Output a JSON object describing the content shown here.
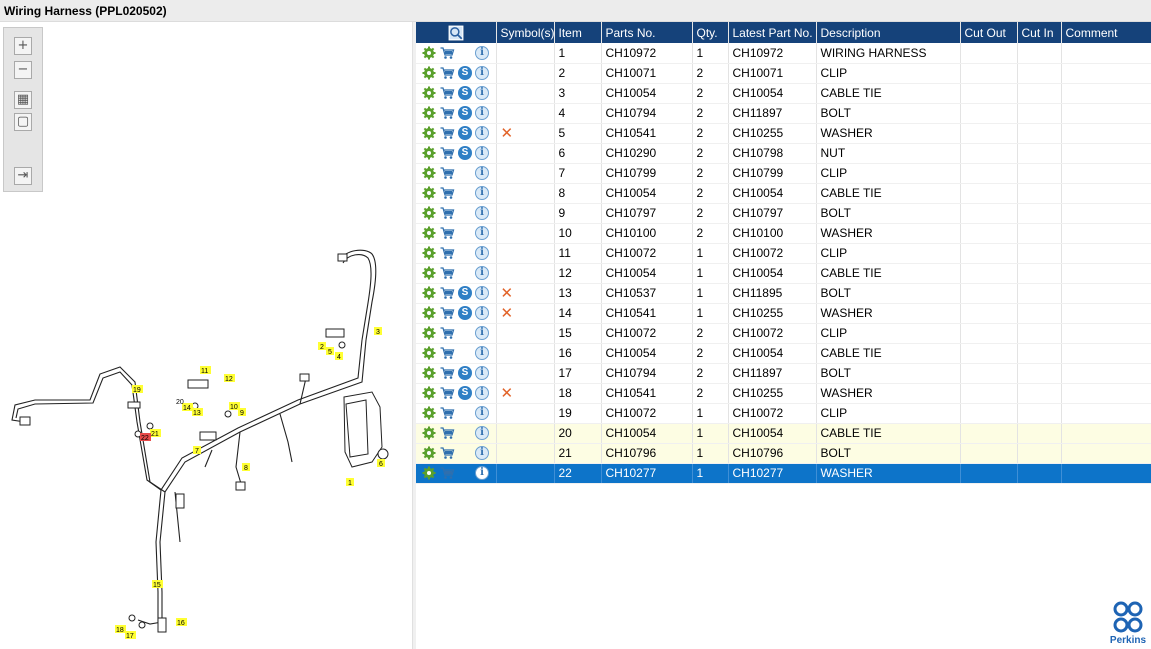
{
  "window": {
    "title": "Wiring Harness (PPL020502)"
  },
  "toolbox": {
    "zoom_in": "+",
    "zoom_out": "−",
    "fit": "▦",
    "actual": "▢",
    "pane": "⇥"
  },
  "diagram": {
    "callouts": [
      "1",
      "2",
      "3",
      "4",
      "5",
      "6",
      "7",
      "8",
      "9",
      "10",
      "11",
      "12",
      "13",
      "14",
      "15",
      "16",
      "17",
      "18",
      "19",
      "20",
      "21",
      "22"
    ],
    "highlight_color": "#e84a4a",
    "callout_color": "#ffff33"
  },
  "table": {
    "header_bg": "#15427a",
    "columns": [
      "Symbol(s)",
      "Item",
      "Parts No.",
      "Qty.",
      "Latest Part No.",
      "Description",
      "Cut Out",
      "Cut In",
      "Comment"
    ],
    "rows": [
      {
        "item": "1",
        "part": "CH10972",
        "qty": "1",
        "latest": "CH10972",
        "desc": "WIRING HARNESS",
        "s": false,
        "x": false
      },
      {
        "item": "2",
        "part": "CH10071",
        "qty": "2",
        "latest": "CH10071",
        "desc": "CLIP",
        "s": true,
        "x": false
      },
      {
        "item": "3",
        "part": "CH10054",
        "qty": "2",
        "latest": "CH10054",
        "desc": "CABLE TIE",
        "s": true,
        "x": false
      },
      {
        "item": "4",
        "part": "CH10794",
        "qty": "2",
        "latest": "CH11897",
        "desc": "BOLT",
        "s": true,
        "x": false
      },
      {
        "item": "5",
        "part": "CH10541",
        "qty": "2",
        "latest": "CH10255",
        "desc": "WASHER",
        "s": true,
        "x": true
      },
      {
        "item": "6",
        "part": "CH10290",
        "qty": "2",
        "latest": "CH10798",
        "desc": "NUT",
        "s": true,
        "x": false
      },
      {
        "item": "7",
        "part": "CH10799",
        "qty": "2",
        "latest": "CH10799",
        "desc": "CLIP",
        "s": false,
        "x": false
      },
      {
        "item": "8",
        "part": "CH10054",
        "qty": "2",
        "latest": "CH10054",
        "desc": "CABLE TIE",
        "s": false,
        "x": false
      },
      {
        "item": "9",
        "part": "CH10797",
        "qty": "2",
        "latest": "CH10797",
        "desc": "BOLT",
        "s": false,
        "x": false
      },
      {
        "item": "10",
        "part": "CH10100",
        "qty": "2",
        "latest": "CH10100",
        "desc": "WASHER",
        "s": false,
        "x": false
      },
      {
        "item": "11",
        "part": "CH10072",
        "qty": "1",
        "latest": "CH10072",
        "desc": "CLIP",
        "s": false,
        "x": false
      },
      {
        "item": "12",
        "part": "CH10054",
        "qty": "1",
        "latest": "CH10054",
        "desc": "CABLE TIE",
        "s": false,
        "x": false
      },
      {
        "item": "13",
        "part": "CH10537",
        "qty": "1",
        "latest": "CH11895",
        "desc": "BOLT",
        "s": true,
        "x": true
      },
      {
        "item": "14",
        "part": "CH10541",
        "qty": "1",
        "latest": "CH10255",
        "desc": "WASHER",
        "s": true,
        "x": true
      },
      {
        "item": "15",
        "part": "CH10072",
        "qty": "2",
        "latest": "CH10072",
        "desc": "CLIP",
        "s": false,
        "x": false
      },
      {
        "item": "16",
        "part": "CH10054",
        "qty": "2",
        "latest": "CH10054",
        "desc": "CABLE TIE",
        "s": false,
        "x": false
      },
      {
        "item": "17",
        "part": "CH10794",
        "qty": "2",
        "latest": "CH11897",
        "desc": "BOLT",
        "s": true,
        "x": false
      },
      {
        "item": "18",
        "part": "CH10541",
        "qty": "2",
        "latest": "CH10255",
        "desc": "WASHER",
        "s": true,
        "x": true
      },
      {
        "item": "19",
        "part": "CH10072",
        "qty": "1",
        "latest": "CH10072",
        "desc": "CLIP",
        "s": false,
        "x": false
      },
      {
        "item": "20",
        "part": "CH10054",
        "qty": "1",
        "latest": "CH10054",
        "desc": "CABLE TIE",
        "s": false,
        "x": false
      },
      {
        "item": "21",
        "part": "CH10796",
        "qty": "1",
        "latest": "CH10796",
        "desc": "BOLT",
        "s": false,
        "x": false
      },
      {
        "item": "22",
        "part": "CH10277",
        "qty": "1",
        "latest": "CH10277",
        "desc": "WASHER",
        "s": false,
        "x": false
      }
    ],
    "highlighted_items": [
      "20",
      "21"
    ],
    "selected_item": "22",
    "selected_color": "#0d74c9"
  },
  "brand": {
    "name": "Perkins",
    "color": "#1e64b4"
  }
}
